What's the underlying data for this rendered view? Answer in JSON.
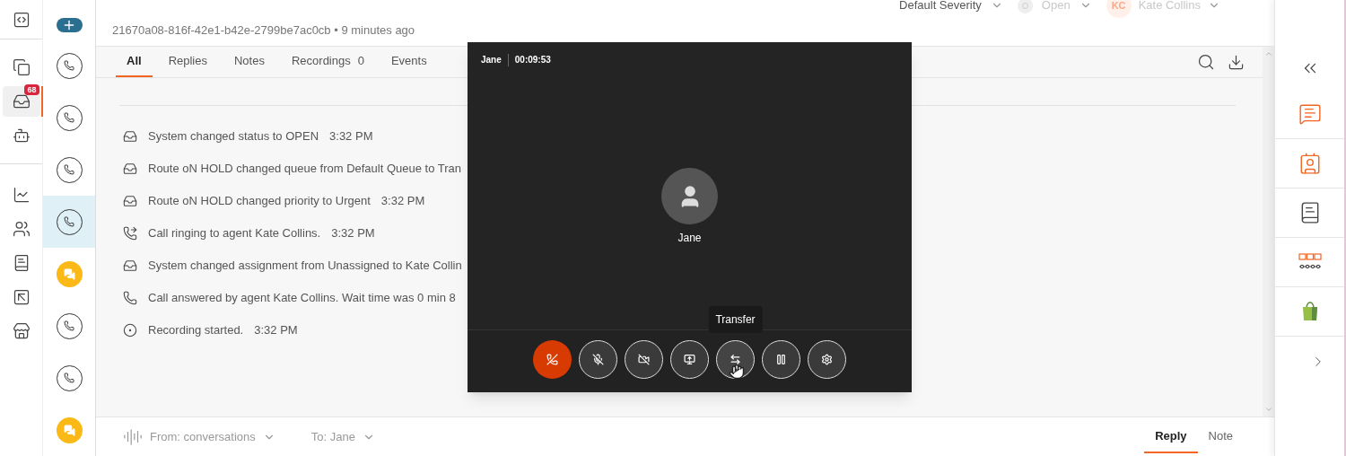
{
  "nav": [
    {
      "kind": "code",
      "selected": false
    },
    {
      "kind": "copy",
      "selected": false
    },
    {
      "kind": "inbox",
      "selected": true,
      "badge": "68"
    },
    {
      "kind": "bot",
      "selected": false
    },
    {
      "kind": "chart",
      "selected": false
    },
    {
      "kind": "users",
      "selected": false
    },
    {
      "kind": "book",
      "selected": false
    },
    {
      "kind": "frame",
      "selected": false
    },
    {
      "kind": "store",
      "selected": false
    }
  ],
  "conversations": [
    {
      "kind": "call",
      "selected": false
    },
    {
      "kind": "call",
      "selected": false
    },
    {
      "kind": "call",
      "selected": false
    },
    {
      "kind": "call",
      "selected": true
    },
    {
      "kind": "chat",
      "selected": false
    },
    {
      "kind": "call",
      "selected": false
    },
    {
      "kind": "call",
      "selected": false
    },
    {
      "kind": "chat",
      "selected": false
    }
  ],
  "header": {
    "id": "21670a08-816f-42e1-b42e-2799be7ac0cb",
    "separator": "•",
    "age": "9 minutes ago",
    "severity": {
      "label": "Default Severity",
      "disabled": false
    },
    "status": {
      "label": "Open",
      "disabled": true
    },
    "assignee": {
      "initials": "KC",
      "label": "Kate Collins",
      "disabled": true
    }
  },
  "tabs": [
    {
      "label": "All",
      "selected": true
    },
    {
      "label": "Replies",
      "selected": false
    },
    {
      "label": "Notes",
      "selected": false
    },
    {
      "label": "Recordings",
      "count": "0",
      "selected": false
    },
    {
      "label": "Events",
      "selected": false
    }
  ],
  "events": [
    {
      "kind": "system",
      "text": "System changed status to OPEN",
      "time": "3:32 PM"
    },
    {
      "kind": "system",
      "text": "Route oN HOLD changed queue from Default Queue to Tran"
    },
    {
      "kind": "system",
      "text": "Route oN HOLD changed priority to Urgent",
      "time": "3:32 PM"
    },
    {
      "kind": "ringing",
      "text": "Call ringing to agent Kate Collins.",
      "time": "3:32 PM"
    },
    {
      "kind": "system",
      "text": "System changed assignment from Unassigned to Kate Collin"
    },
    {
      "kind": "call",
      "text": "Call answered by agent Kate Collins. Wait time was 0 min 8"
    },
    {
      "kind": "recording",
      "text": "Recording started.",
      "time": "3:32 PM"
    }
  ],
  "composer": {
    "from": "From: conversations",
    "to": "To: Jane",
    "modes": [
      {
        "label": "Reply",
        "selected": true
      },
      {
        "label": "Note",
        "selected": false
      }
    ]
  },
  "call": {
    "caller": "Jane",
    "timer": "00:09:53",
    "name": "Jane",
    "tooltip": "Transfer",
    "controls": [
      {
        "kind": "hangup",
        "hovered": false
      },
      {
        "kind": "mute",
        "hovered": false
      },
      {
        "kind": "video",
        "hovered": false
      },
      {
        "kind": "share",
        "hovered": false
      },
      {
        "kind": "transfer",
        "hovered": true
      },
      {
        "kind": "hold",
        "hovered": false
      },
      {
        "kind": "settings",
        "hovered": false
      }
    ]
  },
  "apps": [
    {
      "kind": "messages"
    },
    {
      "kind": "contact"
    },
    {
      "kind": "book"
    },
    {
      "kind": "workflow"
    },
    {
      "kind": "shop"
    }
  ]
}
